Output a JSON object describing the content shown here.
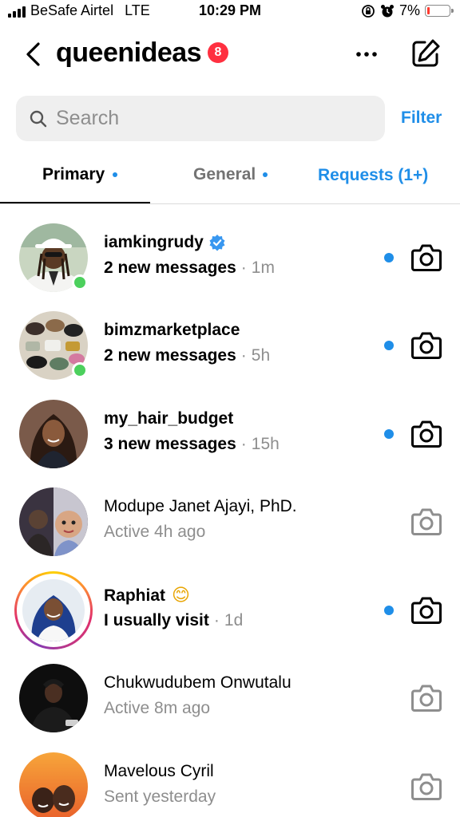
{
  "status_bar": {
    "carrier": "BeSafe Airtel",
    "network": "LTE",
    "time": "10:29 PM",
    "battery_percent": "7%",
    "battery_level": 0.07
  },
  "header": {
    "username": "queenideas",
    "unread_badge": "8"
  },
  "search": {
    "placeholder": "Search",
    "filter_label": "Filter"
  },
  "tabs": [
    {
      "label": "Primary",
      "active": true,
      "has_dot": true
    },
    {
      "label": "General",
      "active": false,
      "has_dot": true
    },
    {
      "label": "Requests (1+)",
      "active": false,
      "has_dot": false
    }
  ],
  "colors": {
    "accent_blue": "#1f8ee8",
    "badge_red": "#ff3040",
    "online_green": "#4cd05d",
    "muted_text": "#8e8e8e"
  },
  "conversations": [
    {
      "name": "iamkingrudy",
      "verified": true,
      "preview": "2 new messages",
      "time": "1m",
      "unread": true,
      "online": true,
      "story_ring": false,
      "avatar_icon": "person-avatar"
    },
    {
      "name": "bimzmarketplace",
      "verified": false,
      "preview": "2 new messages",
      "time": "5h",
      "unread": true,
      "online": true,
      "story_ring": false,
      "avatar_icon": "store-avatar"
    },
    {
      "name": "my_hair_budget",
      "verified": false,
      "preview": "3 new messages",
      "time": "15h",
      "unread": true,
      "online": false,
      "story_ring": false,
      "avatar_icon": "person-avatar"
    },
    {
      "name": "Modupe Janet Ajayi, PhD.",
      "verified": false,
      "preview": "Active 4h ago",
      "time": "",
      "unread": false,
      "online": false,
      "story_ring": false,
      "avatar_icon": "person-avatar"
    },
    {
      "name": "Raphiat",
      "emoji": "😊",
      "verified": false,
      "preview": "I usually visit",
      "time": "1d",
      "unread": true,
      "online": false,
      "story_ring": true,
      "avatar_icon": "person-avatar"
    },
    {
      "name": "Chukwudubem Onwutalu",
      "verified": false,
      "preview": "Active 8m ago",
      "time": "",
      "unread": false,
      "online": false,
      "story_ring": false,
      "avatar_icon": "person-avatar"
    },
    {
      "name": "Mavelous Cyril",
      "verified": false,
      "preview": "Sent yesterday",
      "time": "",
      "unread": false,
      "online": false,
      "story_ring": false,
      "avatar_icon": "person-avatar"
    }
  ]
}
